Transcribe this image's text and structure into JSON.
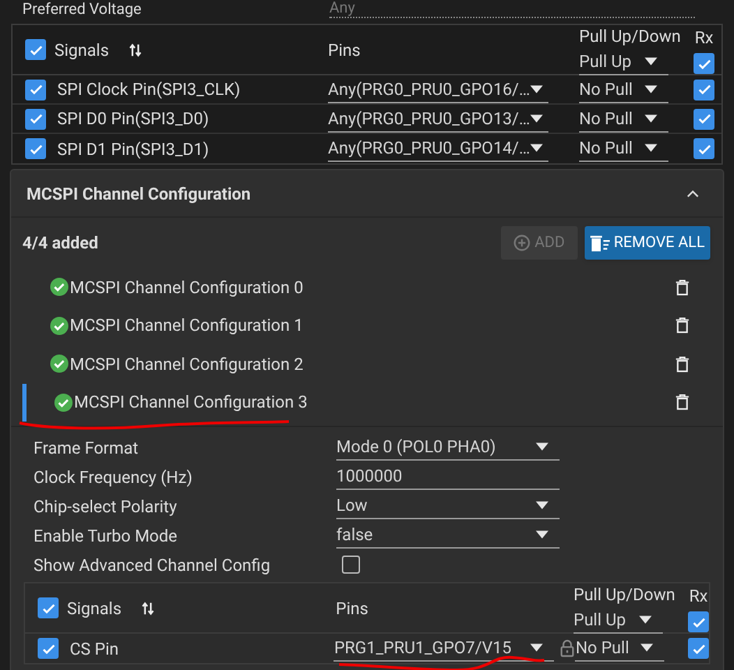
{
  "top_row": {
    "label": "Preferred Voltage",
    "placeholder": "Any"
  },
  "signals_table": {
    "select_all_checked": true,
    "columns": [
      "Signals",
      "Pins",
      "Pull Up/Down",
      "Rx"
    ],
    "pull_all": "Pull Up",
    "rx_all_checked": true,
    "rows": [
      {
        "checked": true,
        "signal": "SPI Clock Pin(SPI3_CLK)",
        "pin": "Any(PRG0_PRU0_GPO16/…",
        "locked": false,
        "pull": "No Pull",
        "rx_checked": true
      },
      {
        "checked": true,
        "signal": "SPI D0 Pin(SPI3_D0)",
        "pin": "Any(PRG0_PRU0_GPO13/…",
        "locked": false,
        "pull": "No Pull",
        "rx_checked": true
      },
      {
        "checked": true,
        "signal": "SPI D1 Pin(SPI3_D1)",
        "pin": "Any(PRG0_PRU0_GPO14/…",
        "locked": false,
        "pull": "No Pull",
        "rx_checked": true
      }
    ]
  },
  "channel_panel": {
    "title": "MCSPI Channel Configuration",
    "expanded": true,
    "count": "4/4 added",
    "add_button": {
      "label": "ADD",
      "disabled": true
    },
    "remove_all_button": {
      "label": "REMOVE ALL"
    },
    "items": [
      {
        "label": "MCSPI Channel Configuration 0",
        "selected": false
      },
      {
        "label": "MCSPI Channel Configuration 1",
        "selected": false
      },
      {
        "label": "MCSPI Channel Configuration 2",
        "selected": false
      },
      {
        "label": "MCSPI Channel Configuration 3",
        "selected": true
      }
    ],
    "fields": [
      {
        "kind": "select",
        "label": "Frame Format",
        "value": "Mode 0 (POL0 PHA0)"
      },
      {
        "kind": "text",
        "label": "Clock Frequency (Hz)",
        "value": "1000000"
      },
      {
        "kind": "select",
        "label": "Chip-select Polarity",
        "value": "Low"
      },
      {
        "kind": "select",
        "label": "Enable Turbo Mode",
        "value": "false"
      },
      {
        "kind": "checkbox",
        "label": "Show Advanced Channel Config",
        "checked": false
      }
    ],
    "signals_table": {
      "select_all_checked": true,
      "columns": [
        "Signals",
        "Pins",
        "Pull Up/Down",
        "Rx"
      ],
      "pull_all": "Pull Up",
      "rx_all_checked": true,
      "rows": [
        {
          "checked": true,
          "signal": "CS Pin",
          "pin": "PRG1_PRU1_GPO7/V15",
          "locked": true,
          "pull": "No Pull",
          "rx_checked": true
        }
      ]
    }
  }
}
